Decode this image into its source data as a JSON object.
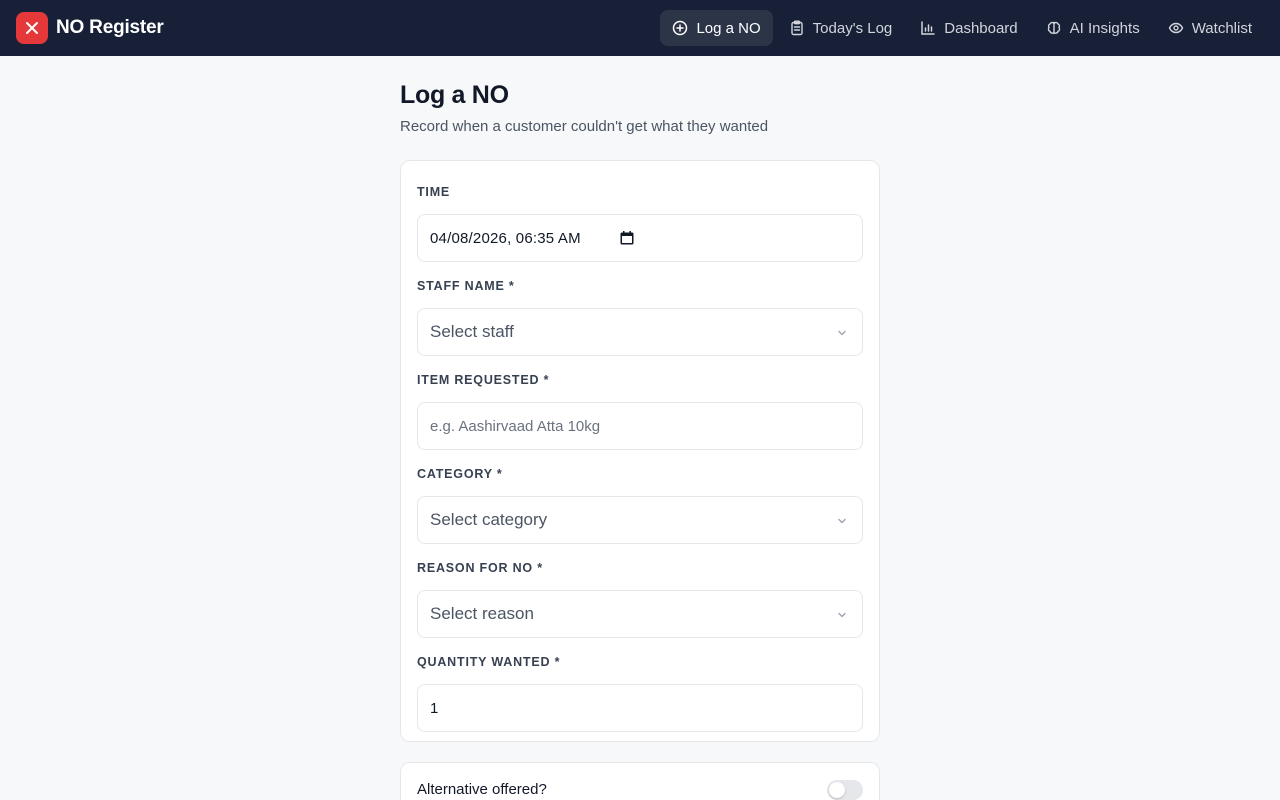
{
  "app": {
    "title": "NO Register"
  },
  "nav": {
    "items": [
      {
        "label": "Log a NO",
        "icon": "plus-circle-icon",
        "active": true
      },
      {
        "label": "Today's Log",
        "icon": "clipboard-icon",
        "active": false
      },
      {
        "label": "Dashboard",
        "icon": "bar-chart-icon",
        "active": false
      },
      {
        "label": "AI Insights",
        "icon": "brain-icon",
        "active": false
      },
      {
        "label": "Watchlist",
        "icon": "eye-icon",
        "active": false
      }
    ]
  },
  "page": {
    "title": "Log a NO",
    "subtitle": "Record when a customer couldn't get what they wanted"
  },
  "form": {
    "time": {
      "label": "TIME",
      "value": "04/08/2026, 06:35 AM"
    },
    "staff": {
      "label": "STAFF NAME *",
      "placeholder": "Select staff"
    },
    "item": {
      "label": "ITEM REQUESTED *",
      "placeholder": "e.g. Aashirvaad Atta 10kg"
    },
    "category": {
      "label": "CATEGORY *",
      "placeholder": "Select category"
    },
    "reason": {
      "label": "REASON FOR NO *",
      "placeholder": "Select reason"
    },
    "quantity": {
      "label": "QUANTITY WANTED *",
      "value": "1"
    }
  },
  "alternative": {
    "label": "Alternative offered?",
    "enabled": false
  },
  "colors": {
    "nav_bg": "#172036",
    "accent": "#e5383b",
    "page_bg": "#f7f8fa"
  }
}
